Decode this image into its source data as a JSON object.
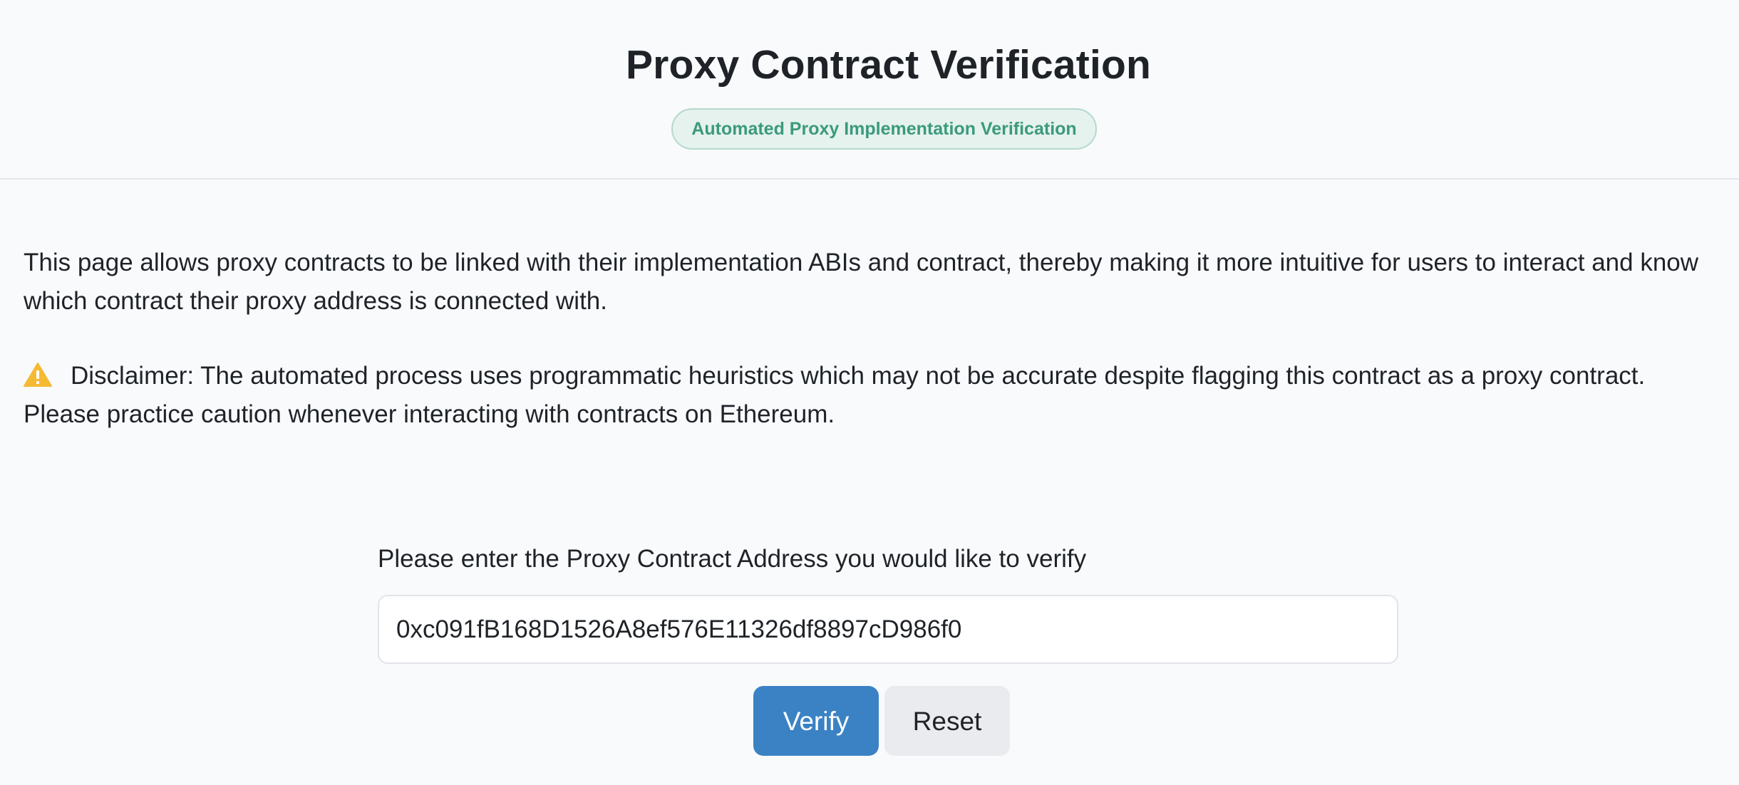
{
  "header": {
    "title": "Proxy Contract Verification",
    "badge": "Automated Proxy Implementation Verification"
  },
  "intro": {
    "description": "This page allows proxy contracts to be linked with their implementation ABIs and contract, thereby making it more intuitive for users to interact and know which contract their proxy address is connected with.",
    "disclaimer": "Disclaimer: The automated process uses programmatic heuristics which may not be accurate despite flagging this contract as a proxy contract. Please practice caution whenever interacting with contracts on Ethereum.",
    "disclaimer_icon": "warning-triangle-icon",
    "warning_color": "#f5b932"
  },
  "form": {
    "label": "Please enter the Proxy Contract Address you would like to verify",
    "address_value": "0xc091fB168D1526A8ef576E11326df8897cD986f0",
    "verify_label": "Verify",
    "reset_label": "Reset"
  },
  "colors": {
    "primary": "#3a82c4",
    "badge_text": "#3a9a7c",
    "badge_bg": "#e6f2ee"
  }
}
